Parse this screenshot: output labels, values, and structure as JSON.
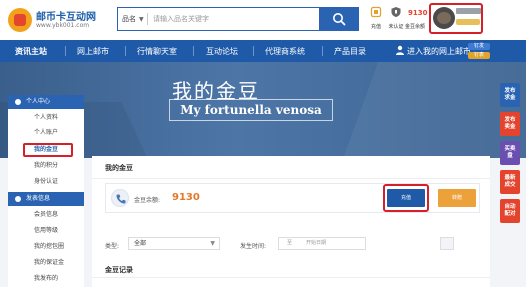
{
  "header": {
    "logo_title": "邮币卡互动网",
    "logo_url": "www.ybk001.com",
    "search": {
      "category": "品名",
      "placeholder": "请输入品名关键字"
    },
    "recharge_label": "充值",
    "verify_label": "未认证",
    "bean_count": "9130",
    "bean_label": "金豆余额"
  },
  "nav": {
    "items": [
      "资讯主站",
      "网上邮市",
      "行情聊天室",
      "互动论坛",
      "代理商系统",
      "产品目录"
    ],
    "enter_market": "进入我的网上邮市",
    "badge_top": "钉发",
    "badge_bottom": "钉表"
  },
  "banner": {
    "title": "我的金豆",
    "subtitle": "My fortunella venosa"
  },
  "sidebar": {
    "section1": "个人中心",
    "items1": [
      "个人资料",
      "个人账户",
      "我的金豆",
      "我的积分",
      "身份认证"
    ],
    "section2": "发表信息",
    "items2": [
      "会员信息",
      "信用等级",
      "我的挖包圈",
      "我的保证金",
      "我发布的"
    ]
  },
  "main": {
    "title": "我的金豆",
    "balance_label": "金豆余额:",
    "balance_value": "9130",
    "recharge_button": "充值",
    "transfer_button": "转赠",
    "type_label": "类型:",
    "type_value": "全部",
    "time_label": "发生时间:",
    "time_sep": "至",
    "time_end_placeholder": "开始日期",
    "records_title": "金豆记录"
  },
  "float_buttons": [
    {
      "label": "发布\n求金"
    },
    {
      "label": "发布\n卖金"
    },
    {
      "label": "买卖\n盘"
    },
    {
      "label": "最新\n成交"
    },
    {
      "label": "自动\n配对"
    }
  ],
  "colors": {
    "brand_blue": "#1e5aa8",
    "highlight_red": "#d42029",
    "bean_orange": "#e4772a",
    "transfer_orange": "#eda13a"
  }
}
